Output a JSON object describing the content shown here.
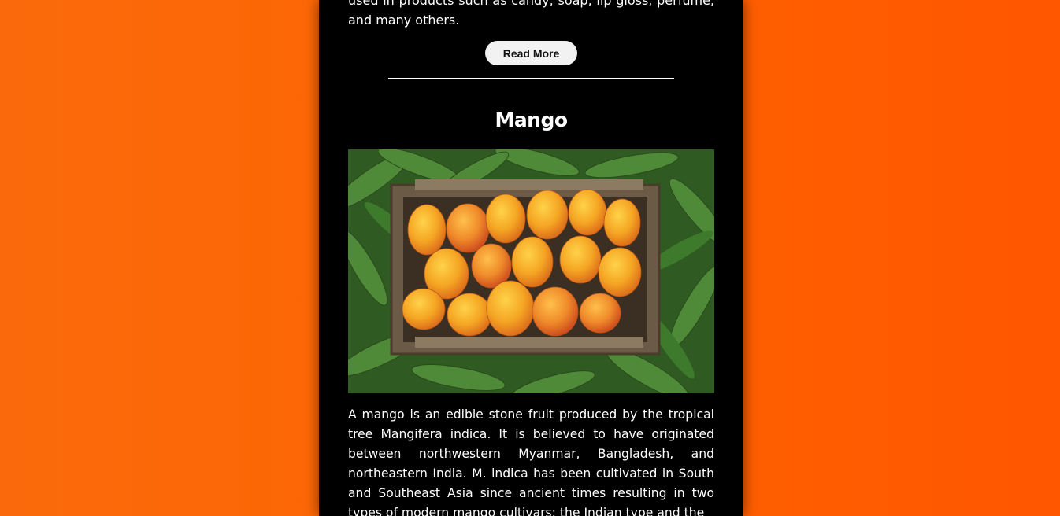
{
  "previous_section": {
    "text_tail": "used in products such as candy, soap, lip gloss, perfume, and many others.",
    "read_more_label": "Read More"
  },
  "mango": {
    "title": "Mango",
    "description": "A mango is an edible stone fruit produced by the tropical tree Mangifera indica. It is believed to have originated between northwestern Myanmar, Bangladesh, and northeastern India. M. indica has been cultivated in South and Southeast Asia since ancient times resulting in two types of modern mango cultivars: the Indian type and the"
  },
  "colors": {
    "background": "#ff6400",
    "card": "#000000",
    "button_bg": "#f2f2f2"
  }
}
